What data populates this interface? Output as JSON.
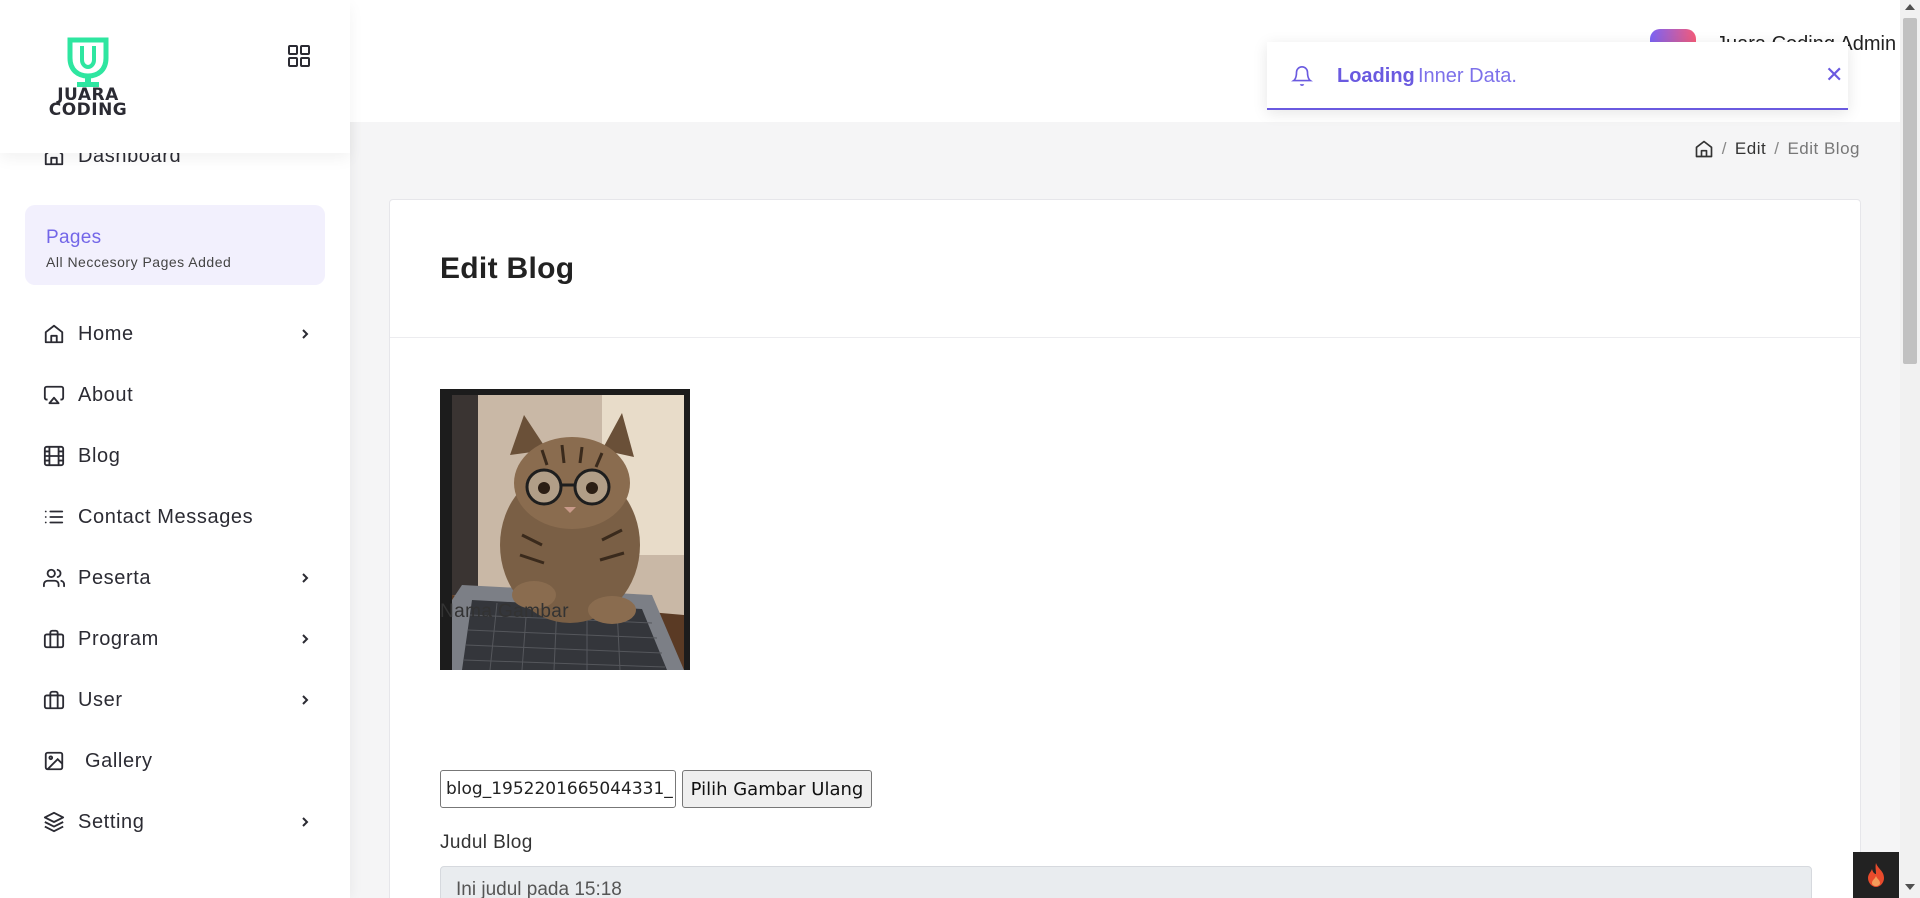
{
  "brand": {
    "logo_text_line1": "JUARA",
    "logo_text_line2": "CODING",
    "accent": "#2ee6a0"
  },
  "sidebar": {
    "dashboard": "Dashboard",
    "pages_box": {
      "title": "Pages",
      "subtitle": "All Neccesory Pages Added"
    },
    "items": [
      {
        "label": "Home",
        "icon": "home-icon",
        "has_submenu": true
      },
      {
        "label": "About",
        "icon": "airplay-icon",
        "has_submenu": false
      },
      {
        "label": "Blog",
        "icon": "film-icon",
        "has_submenu": false
      },
      {
        "label": "Contact Messages",
        "icon": "list-icon",
        "has_submenu": false
      },
      {
        "label": "Peserta",
        "icon": "users-icon",
        "has_submenu": true
      },
      {
        "label": "Program",
        "icon": "briefcase-icon",
        "has_submenu": true
      },
      {
        "label": "User",
        "icon": "briefcase-icon",
        "has_submenu": true
      },
      {
        "label": "Gallery",
        "icon": "image-icon",
        "has_submenu": false
      },
      {
        "label": "Setting",
        "icon": "layers-icon",
        "has_submenu": true
      }
    ]
  },
  "header": {
    "user_name": "Juara Coding Admin"
  },
  "toast": {
    "strong": "Loading",
    "message": "Inner Data.",
    "close": "✕"
  },
  "breadcrumb": {
    "edit": "Edit",
    "current": "Edit Blog",
    "sep": "/"
  },
  "form": {
    "title": "Edit Blog",
    "image_label": "Nama Gambar",
    "file_value": "blog_1952201665044331_",
    "file_button": "Pilih Gambar Ulang",
    "judul_label": "Judul Blog",
    "judul_value": "Ini judul pada 15:18"
  },
  "colors": {
    "primary": "#6a5ae0",
    "pages_bg": "#f2f0fd"
  }
}
